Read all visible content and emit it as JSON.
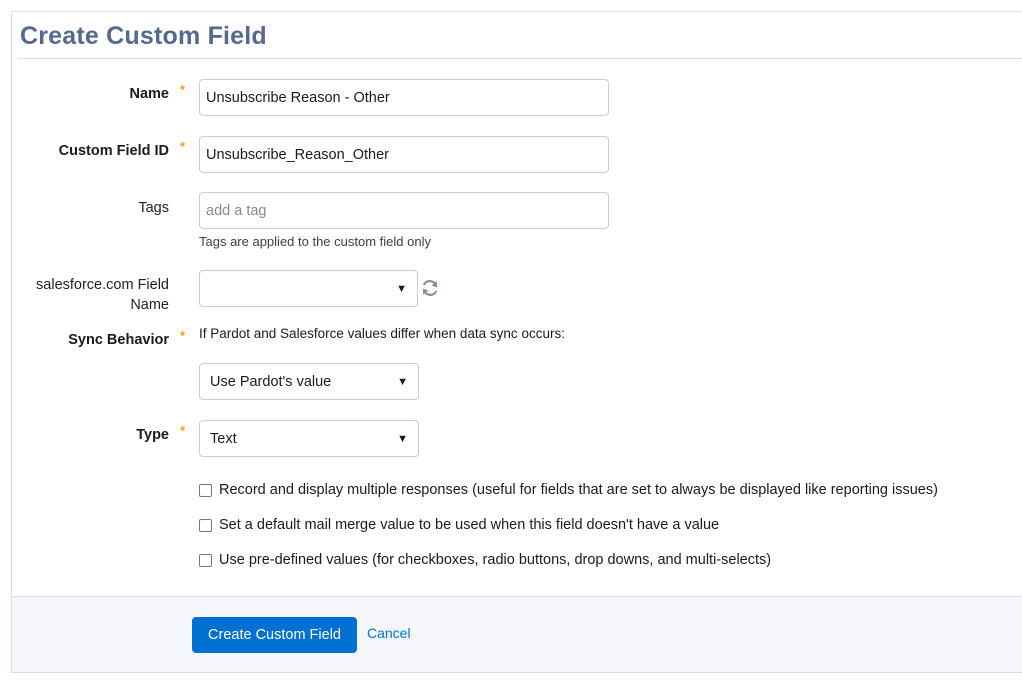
{
  "page": {
    "title": "Create Custom Field"
  },
  "fields": {
    "name": {
      "label": "Name",
      "value": "Unsubscribe Reason - Other"
    },
    "custom_field_id": {
      "label": "Custom Field ID",
      "value": "Unsubscribe_Reason_Other"
    },
    "tags": {
      "label": "Tags",
      "placeholder": "add a tag",
      "hint": "Tags are applied to the custom field only"
    },
    "salesforce_field": {
      "label_line1": "salesforce.com Field",
      "label_line2": "Name",
      "value": ""
    },
    "sync_behavior": {
      "label": "Sync Behavior",
      "description": "If Pardot and Salesforce values differ when data sync occurs:",
      "value": "Use Pardot's value"
    },
    "type": {
      "label": "Type",
      "value": "Text"
    }
  },
  "required_marker": "*",
  "options": [
    {
      "label": "Record and display multiple responses (useful for fields that are set to always be displayed like reporting issues)",
      "checked": false
    },
    {
      "label": "Set a default mail merge value to be used when this field doesn't have a value",
      "checked": false
    },
    {
      "label": "Use pre-defined values (for checkboxes, radio buttons, drop downs, and multi-selects)",
      "checked": false
    }
  ],
  "actions": {
    "submit_label": "Create Custom Field",
    "cancel_label": "Cancel"
  },
  "colors": {
    "primary": "#0070d2",
    "required": "#f59a23",
    "title": "#54698d"
  },
  "icons": {
    "refresh": "refresh-icon",
    "dropdown": "chevron-down-icon"
  }
}
